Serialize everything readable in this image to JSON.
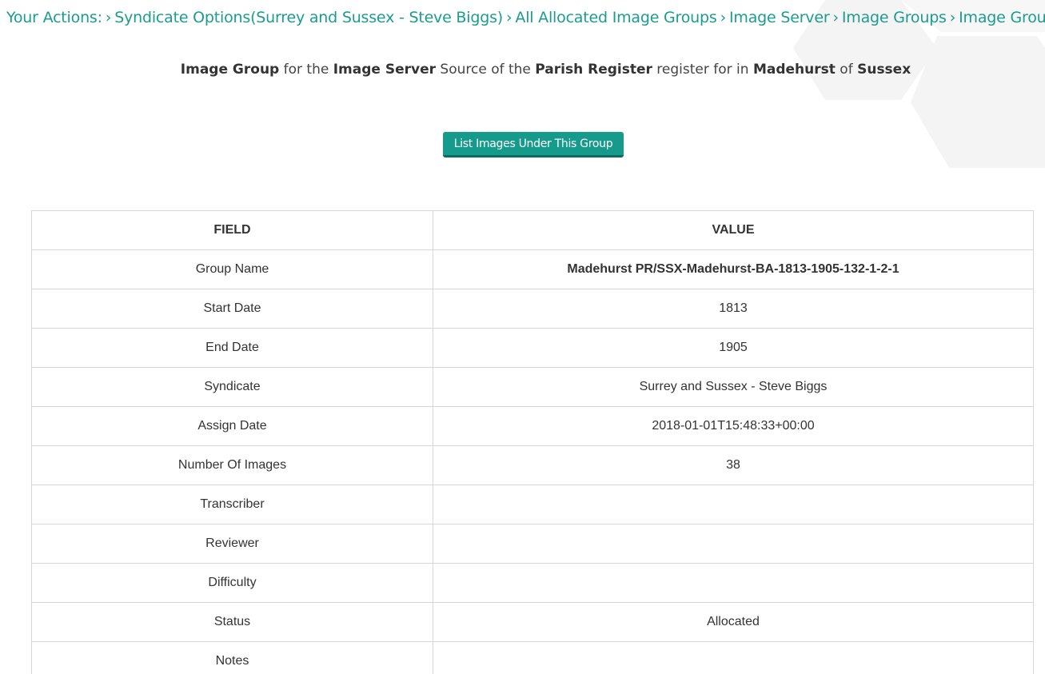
{
  "breadcrumb": {
    "prefix": "Your Actions:",
    "items": [
      "Syndicate Options(Surrey and Sussex - Steve Biggs)",
      "All Allocated Image Groups",
      "Image Server",
      "Image Groups",
      "Image Group"
    ]
  },
  "heading": {
    "part1": "Image Group",
    "part2": " for the ",
    "part3": "Image Server",
    "part4": " Source of the ",
    "part5": "Parish Register",
    "part6": " register for in ",
    "part7": "Madehurst",
    "part8": " of ",
    "part9": "Sussex"
  },
  "button": {
    "label": "List Images Under This Group"
  },
  "table": {
    "headers": {
      "field": "FIELD",
      "value": "VALUE"
    },
    "rows": [
      {
        "field": "Group Name",
        "value": "Madehurst PR/SSX-Madehurst-BA-1813-1905-132-1-2-1"
      },
      {
        "field": "Start Date",
        "value": "1813"
      },
      {
        "field": "End Date",
        "value": "1905"
      },
      {
        "field": "Syndicate",
        "value": "Surrey and Sussex - Steve Biggs"
      },
      {
        "field": "Assign Date",
        "value": "2018-01-01T15:48:33+00:00"
      },
      {
        "field": "Number Of Images",
        "value": "38"
      },
      {
        "field": "Transcriber",
        "value": ""
      },
      {
        "field": "Reviewer",
        "value": ""
      },
      {
        "field": "Difficulty",
        "value": ""
      },
      {
        "field": "Status",
        "value": "Allocated"
      },
      {
        "field": "Notes",
        "value": ""
      }
    ]
  },
  "colors": {
    "accent": "#1a9d8f",
    "button": "#159a8c",
    "border": "#d6d6d6"
  }
}
